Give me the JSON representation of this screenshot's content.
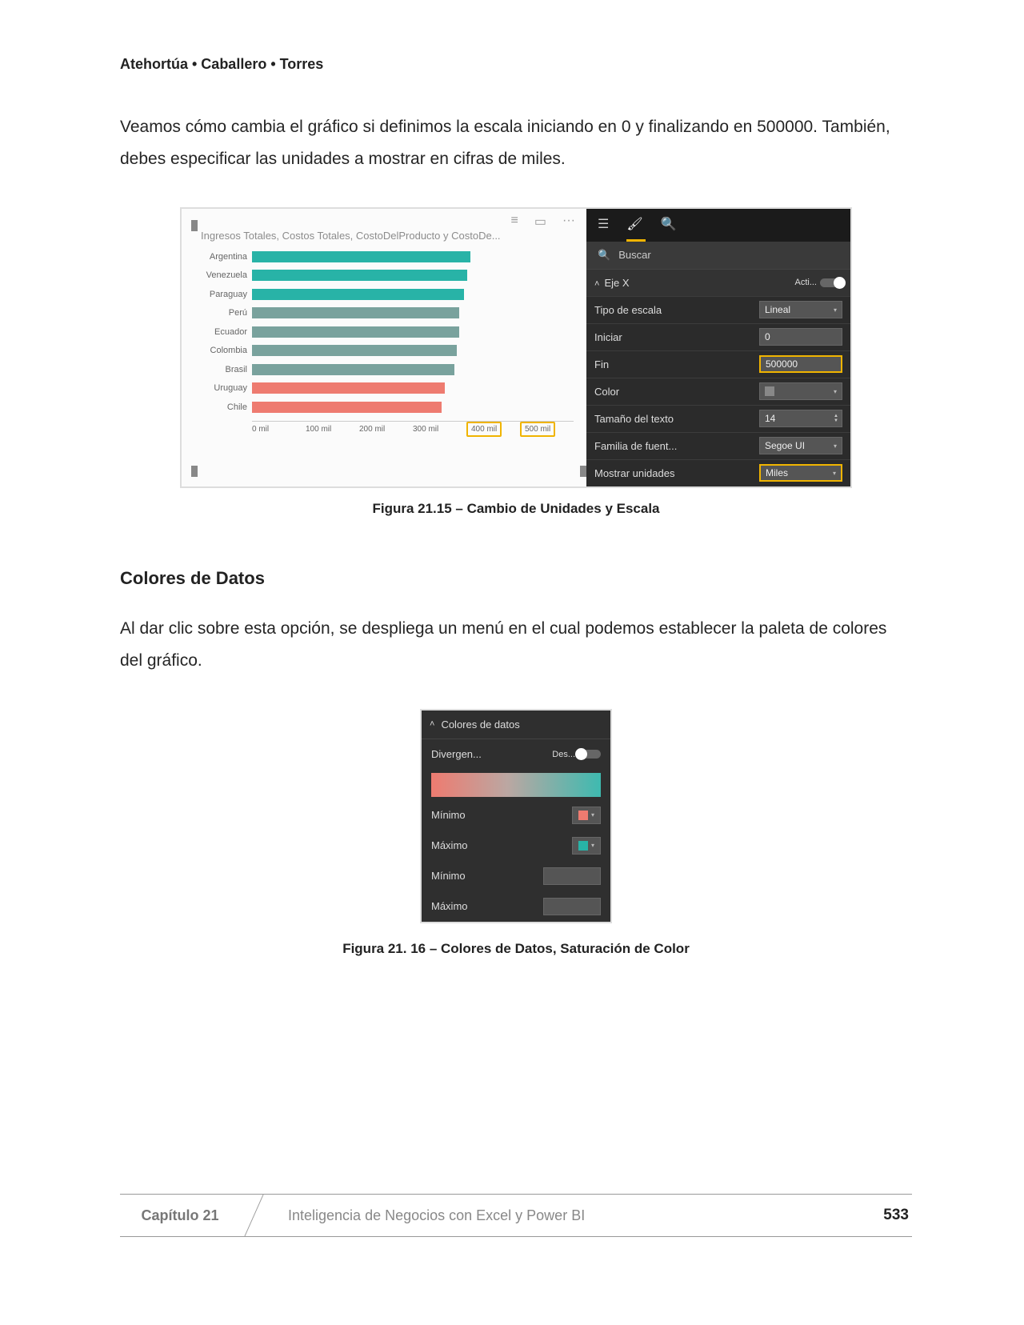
{
  "header": {
    "authors": "Atehortúa • Caballero • Torres"
  },
  "para1": "Veamos cómo cambia el gráfico si definimos la escala iniciando en 0 y finalizando en 500000. También, debes especificar las unidades a mostrar en cifras de miles.",
  "figure15": {
    "chart_title": "Ingresos Totales, Costos Totales, CostoDelProducto y CostoDe...",
    "menu_ellipsis": "···",
    "caption": "Figura 21.15 – Cambio de Unidades y Escala"
  },
  "chart_data": {
    "type": "bar",
    "orientation": "horizontal",
    "xlabel": "",
    "ylabel": "",
    "x_unit": "mil",
    "xlim": [
      0,
      500
    ],
    "x_ticks": [
      "0 mil",
      "100 mil",
      "200 mil",
      "300 mil",
      "400 mil",
      "500 mil"
    ],
    "categories": [
      "Argentina",
      "Venezuela",
      "Paraguay",
      "Perú",
      "Ecuador",
      "Colombia",
      "Brasil",
      "Uruguay",
      "Chile"
    ],
    "values": [
      340,
      335,
      330,
      322,
      322,
      318,
      315,
      300,
      295
    ],
    "colors": [
      "#28b3a7",
      "#28b3a7",
      "#28b3a7",
      "#79a29d",
      "#79a29d",
      "#79a29d",
      "#79a29d",
      "#ee7b70",
      "#ee7b70"
    ]
  },
  "format_pane": {
    "search_placeholder": "Buscar",
    "section": "Eje X",
    "section_toggle": "Acti...",
    "rows": {
      "tipo_escala": {
        "label": "Tipo de escala",
        "value": "Lineal"
      },
      "iniciar": {
        "label": "Iniciar",
        "value": "0"
      },
      "fin": {
        "label": "Fin",
        "value": "500000"
      },
      "color": {
        "label": "Color"
      },
      "tamano": {
        "label": "Tamaño del texto",
        "value": "14"
      },
      "fuente": {
        "label": "Familia de fuent...",
        "value": "Segoe UI"
      },
      "unidades": {
        "label": "Mostrar unidades",
        "value": "Miles"
      }
    }
  },
  "section2": {
    "heading": "Colores de Datos",
    "para": "Al dar clic sobre esta opción, se despliega un menú en el cual podemos establecer la paleta de colores del gráfico."
  },
  "figure16": {
    "caption": "Figura 21. 16 – Colores de Datos, Saturación de Color",
    "head": "Colores de datos",
    "divergen": "Divergen...",
    "divergen_toggle": "Des...",
    "minimo": "Mínimo",
    "maximo": "Máximo",
    "min_color": "#ee7b70",
    "max_color": "#28b3a7"
  },
  "footer": {
    "chapter": "Capítulo 21",
    "title": "Inteligencia de Negocios con Excel y Power BI",
    "page": "533"
  }
}
